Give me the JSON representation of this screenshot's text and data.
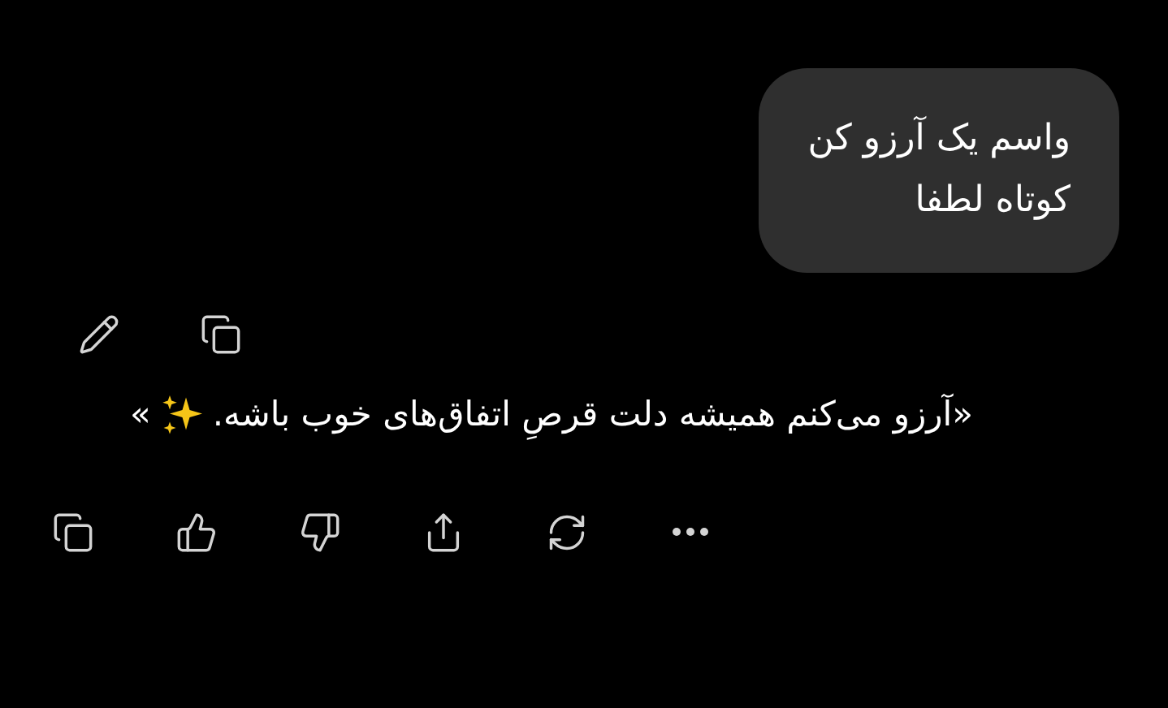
{
  "user_message": {
    "lines": [
      "واسم یک آرزو کن",
      "کوتاه لطفا"
    ]
  },
  "user_actions": [
    {
      "kind": "edit"
    },
    {
      "kind": "copy"
    }
  ],
  "assistant_message": {
    "text": "«آرزو می‌کنم همیشه دلت قرصِ اتفاق‌های خوب باشه.",
    "closing": "»"
  },
  "assistant_actions": [
    {
      "kind": "copy"
    },
    {
      "kind": "like"
    },
    {
      "kind": "dislike"
    },
    {
      "kind": "share"
    },
    {
      "kind": "regenerate"
    },
    {
      "kind": "more"
    }
  ]
}
